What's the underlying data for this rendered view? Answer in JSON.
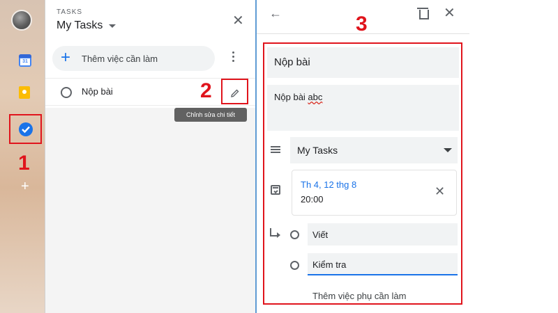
{
  "app": {
    "section_label": "TASKS",
    "list_title": "My Tasks"
  },
  "rail": {
    "calendar_day": "31"
  },
  "list_panel": {
    "add_task_label": "Thêm việc cần làm",
    "tasks": [
      {
        "title": "Nộp bài"
      }
    ],
    "tooltip": "Chỉnh sửa chi tiết"
  },
  "detail_panel": {
    "title": "Nộp bài",
    "description_plain": "Nộp bài ",
    "description_underlined": "abc",
    "list_name": "My Tasks",
    "date": "Th 4, 12 thg 8",
    "time": "20:00",
    "subtasks": [
      {
        "title": "Viết"
      },
      {
        "title": "Kiểm tra"
      }
    ],
    "add_subtask_label": "Thêm việc phụ cần làm"
  },
  "annotations": {
    "marker_1": "1",
    "marker_2": "2",
    "marker_3": "3",
    "color": "#e0141c"
  },
  "colors": {
    "accent": "#1a73e8",
    "divider": "#5f9bd4"
  }
}
